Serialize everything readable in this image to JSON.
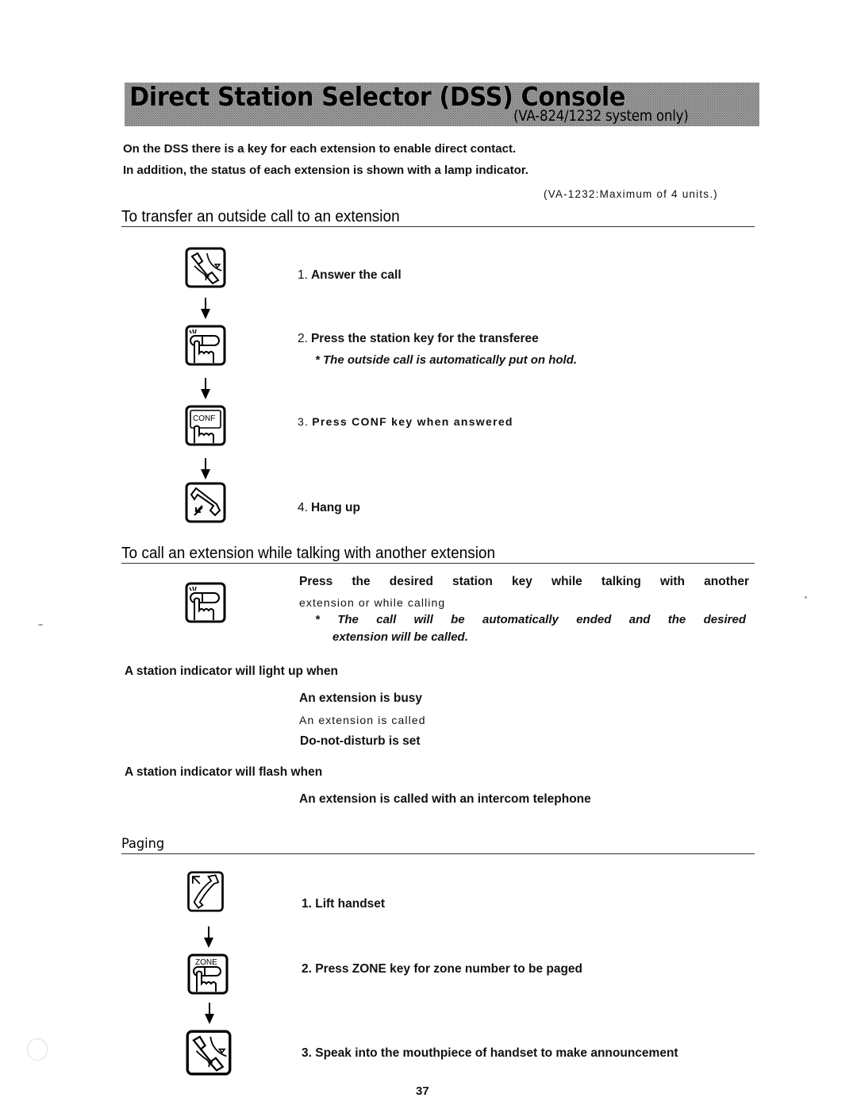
{
  "header": {
    "title": "Direct Station Selector (DSS) Console",
    "subtitle": "(VA-824/1232 system only)"
  },
  "intro": {
    "line1": "On the DSS there is a key for each extension to enable direct contact.",
    "line2": "In addition, the status of each extension is shown with a lamp indicator.",
    "capacity_note": "(VA-1232:Maximum of 4 units.)"
  },
  "transfer": {
    "heading": "To transfer an outside call to an extension",
    "steps": [
      {
        "num": "1.",
        "text": "Answer the call",
        "icon": "answer-handset-icon"
      },
      {
        "num": "2.",
        "text": "Press the station key for the transferee",
        "note": "* The outside call is automatically put on hold.",
        "icon": "station-key-press-icon"
      },
      {
        "num": "3.",
        "text": "Press CONF key when answered",
        "icon": "conf-key-press-icon",
        "icon_label": "CONF"
      },
      {
        "num": "4.",
        "text": "Hang up",
        "icon": "hang-up-icon"
      }
    ]
  },
  "call_while_talking": {
    "heading": "To call an extension while talking with another extension",
    "line1": "Press the desired station key while talking with another",
    "line2": "extension or while calling",
    "note1": "* The call will be automatically ended and the desired",
    "note2": "extension will be called.",
    "icon": "station-key-press-icon"
  },
  "indicator": {
    "light_heading": "A station indicator will light up when",
    "light_items": [
      "An extension is busy",
      "An extension is called",
      "Do-not-disturb is set"
    ],
    "flash_heading": "A station indicator will flash when",
    "flash_items": [
      "An extension is called with an intercom telephone"
    ]
  },
  "paging": {
    "heading": "Paging",
    "steps": [
      {
        "num": "1.",
        "text": "Lift handset",
        "icon": "lift-handset-icon"
      },
      {
        "num": "2.",
        "text": "Press ZONE key for zone number to be paged",
        "icon": "zone-key-press-icon",
        "icon_label": "ZONE"
      },
      {
        "num": "3.",
        "text": "Speak into the mouthpiece of handset to make announcement",
        "icon": "speak-handset-icon"
      }
    ]
  },
  "footer": {
    "page_number": "37"
  }
}
